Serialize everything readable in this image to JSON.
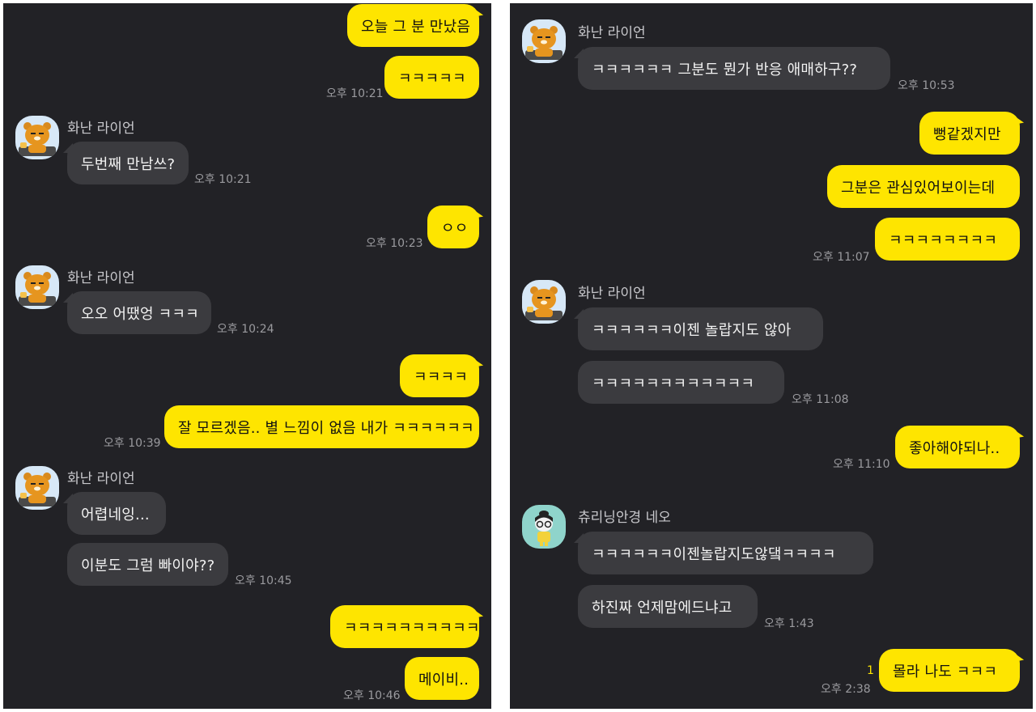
{
  "colors": {
    "background": "#222226",
    "my_bubble": "#FEE500",
    "other_bubble": "#3b3b3f",
    "timestamp": "#9a9a9e"
  },
  "left_panel": {
    "messages": [
      {
        "sender": "me",
        "text": "오늘 그 분 만났음"
      },
      {
        "sender": "me",
        "text": "ㅋㅋㅋㅋㅋ",
        "time": "오후 10:21"
      },
      {
        "sender": "화난 라이언",
        "avatar": "ryan-avatar",
        "text": "두번째 만남쓰?",
        "time": "오후 10:21"
      },
      {
        "sender": "me",
        "text": "ㅇㅇ",
        "time": "오후 10:23"
      },
      {
        "sender": "화난 라이언",
        "avatar": "ryan-avatar",
        "text": "오오 어땠엉 ㅋㅋㅋ",
        "time": "오후 10:24"
      },
      {
        "sender": "me",
        "text": "ㅋㅋㅋㅋ"
      },
      {
        "sender": "me",
        "text": "잘 모르겠음.. 별 느낌이 없음 내가 ㅋㅋㅋㅋㅋㅋ",
        "time": "오후 10:39"
      },
      {
        "sender": "화난 라이언",
        "avatar": "ryan-avatar",
        "text": "어렵네잉..."
      },
      {
        "sender": "화난 라이언",
        "text": "이분도 그럼 빠이야??",
        "time": "오후 10:45"
      },
      {
        "sender": "me",
        "text": "ㅋㅋㅋㅋㅋㅋㅋㅋㅋㅋ"
      },
      {
        "sender": "me",
        "text": "메이비..",
        "time": "오후 10:46"
      }
    ]
  },
  "right_panel": {
    "messages": [
      {
        "sender": "화난 라이언",
        "avatar": "ryan-avatar",
        "text": "ㅋㅋㅋㅋㅋㅋ 그분도 뭔가 반응 애매하구??",
        "time": "오후 10:53"
      },
      {
        "sender": "me",
        "text": "뻥같겠지만"
      },
      {
        "sender": "me",
        "text": "그분은 관심있어보이는데"
      },
      {
        "sender": "me",
        "text": "ㅋㅋㅋㅋㅋㅋㅋㅋ",
        "time": "오후 11:07"
      },
      {
        "sender": "화난 라이언",
        "avatar": "ryan-avatar",
        "text": "ㅋㅋㅋㅋㅋㅋ이젠 놀랍지도 않아"
      },
      {
        "sender": "화난 라이언",
        "text": "ㅋㅋㅋㅋㅋㅋㅋㅋㅋㅋㅋㅋ",
        "time": "오후 11:08"
      },
      {
        "sender": "me",
        "text": "좋아해야되나..",
        "time": "오후 11:10"
      },
      {
        "sender": "츄리닝안경 네오",
        "avatar": "neo-avatar",
        "text": "ㅋㅋㅋㅋㅋㅋ이젠놀랍지도않댘ㅋㅋㅋㅋ"
      },
      {
        "sender": "츄리닝안경 네오",
        "text": "하진짜 언제맘에드냐고",
        "time": "오후 1:43"
      },
      {
        "sender": "me",
        "text": "몰라 나도 ㅋㅋㅋ",
        "time": "오후 2:38",
        "unread": "1"
      }
    ]
  }
}
